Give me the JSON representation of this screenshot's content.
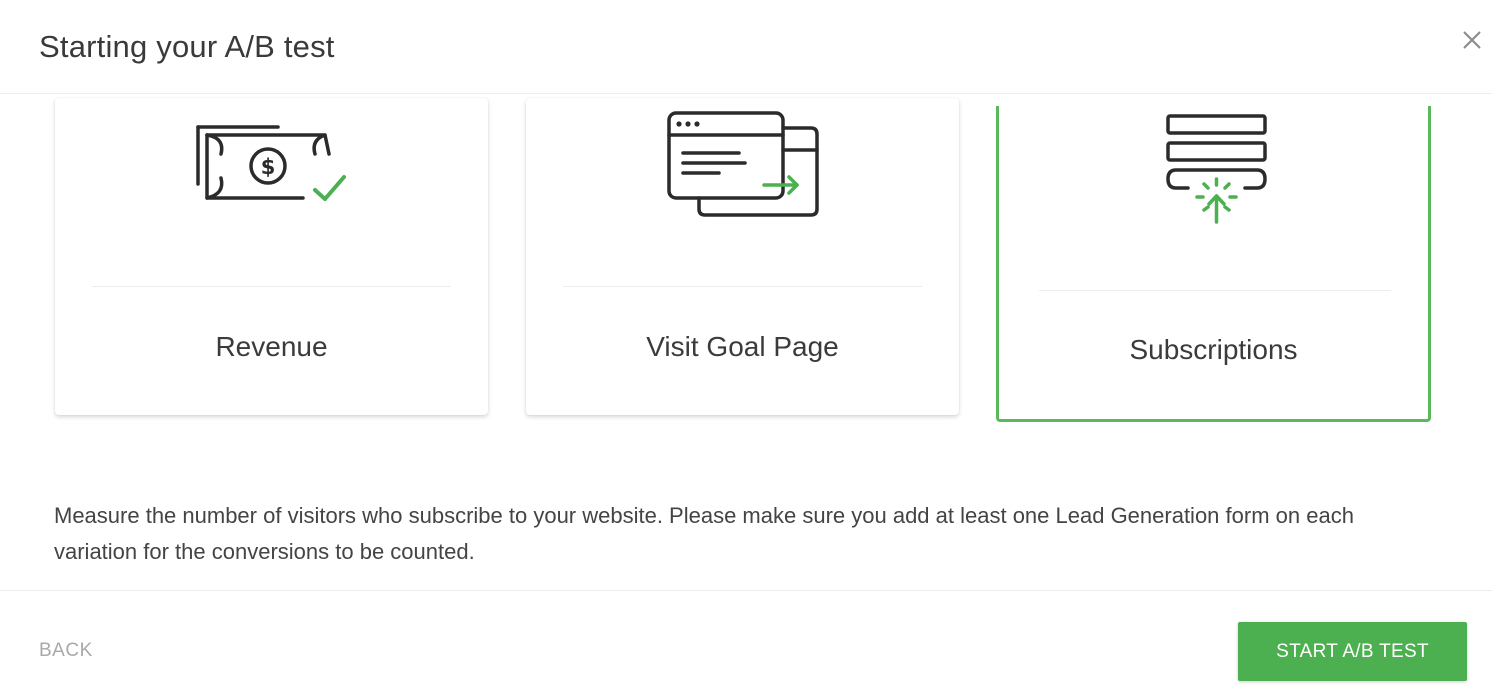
{
  "dialog": {
    "title": "Starting your A/B test",
    "close_icon": "close-icon"
  },
  "goals": [
    {
      "label": "Revenue",
      "icon": "money-check-icon",
      "selected": false
    },
    {
      "label": "Visit Goal Page",
      "icon": "browser-redirect-icon",
      "selected": false
    },
    {
      "label": "Subscriptions",
      "icon": "subscription-form-icon",
      "selected": true
    }
  ],
  "description": "Measure the number of visitors who subscribe to your website. Please make sure you add at least one Lead Generation form on each variation for the conversions to be counted.",
  "footer": {
    "back_label": "BACK",
    "start_label": "START A/B TEST"
  },
  "colors": {
    "accent": "#4caf50",
    "icon_stroke": "#2b2b2b",
    "selected_border": "#5cb85c"
  }
}
